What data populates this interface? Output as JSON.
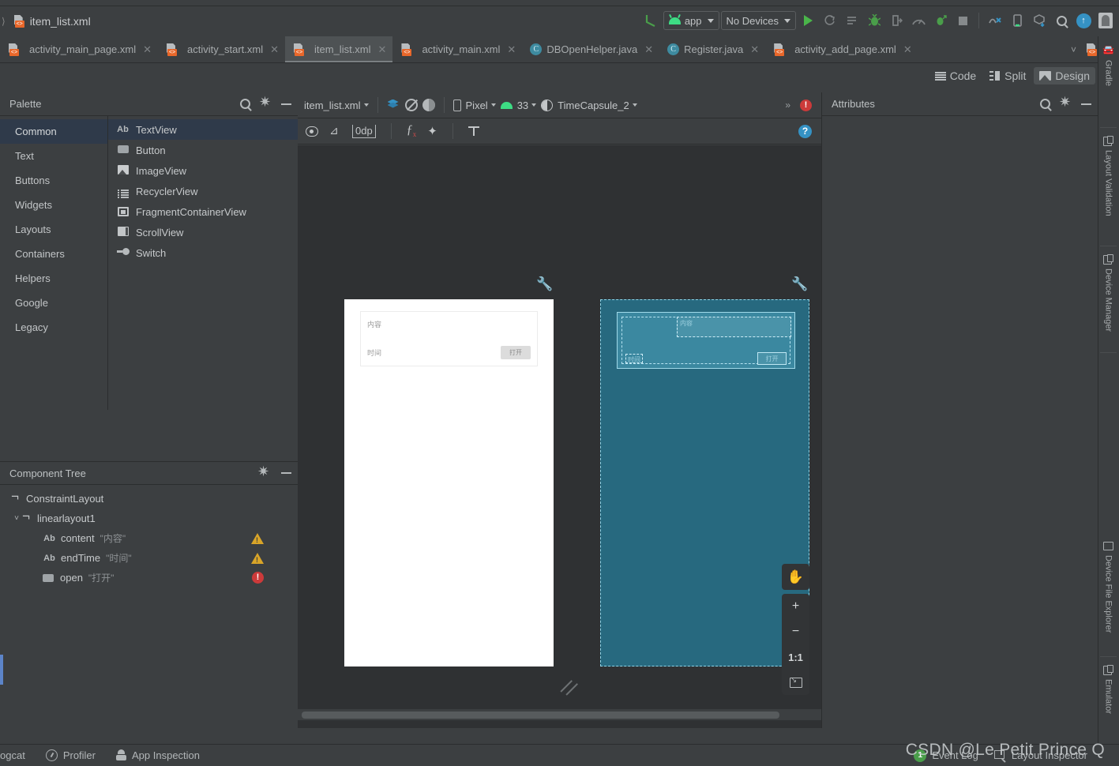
{
  "window": {
    "breadcrumb_file": "item_list.xml"
  },
  "toolbar": {
    "module_selector": "app",
    "device_selector": "No Devices",
    "icons": [
      "back-arrow-icon",
      "run-icon",
      "apply-changes-icon",
      "apply-code-changes-icon",
      "debug-icon",
      "attach-debugger-icon",
      "profiler-icon",
      "run-coverage-icon",
      "stop-icon",
      "avd-manager-icon",
      "device-manager-icon",
      "sdk-manager-icon",
      "search-everywhere-icon",
      "update-icon",
      "account-icon"
    ]
  },
  "editor_tabs": [
    {
      "label": "activity_main_page.xml",
      "type": "xml",
      "active": false
    },
    {
      "label": "activity_start.xml",
      "type": "xml",
      "active": false
    },
    {
      "label": "item_list.xml",
      "type": "xml",
      "active": true
    },
    {
      "label": "activity_main.xml",
      "type": "xml",
      "active": false
    },
    {
      "label": "DBOpenHelper.java",
      "type": "java",
      "active": false
    },
    {
      "label": "Register.java",
      "type": "java",
      "active": false
    },
    {
      "label": "activity_add_page.xml",
      "type": "xml",
      "active": false
    }
  ],
  "view_modes": {
    "code": "Code",
    "split": "Split",
    "design": "Design",
    "selected": "Design"
  },
  "palette": {
    "title": "Palette",
    "categories": [
      {
        "label": "Common",
        "selected": true
      },
      {
        "label": "Text",
        "selected": false
      },
      {
        "label": "Buttons",
        "selected": false
      },
      {
        "label": "Widgets",
        "selected": false
      },
      {
        "label": "Layouts",
        "selected": false
      },
      {
        "label": "Containers",
        "selected": false
      },
      {
        "label": "Helpers",
        "selected": false
      },
      {
        "label": "Google",
        "selected": false
      },
      {
        "label": "Legacy",
        "selected": false
      }
    ],
    "items": [
      {
        "label": "TextView",
        "icon": "ab-icon",
        "selected": true
      },
      {
        "label": "Button",
        "icon": "button-icon",
        "selected": false
      },
      {
        "label": "ImageView",
        "icon": "image-icon",
        "selected": false
      },
      {
        "label": "RecyclerView",
        "icon": "list-icon",
        "selected": false
      },
      {
        "label": "FragmentContainerView",
        "icon": "fragment-icon",
        "selected": false
      },
      {
        "label": "ScrollView",
        "icon": "scroll-icon",
        "selected": false
      },
      {
        "label": "Switch",
        "icon": "switch-icon",
        "selected": false
      }
    ]
  },
  "component_tree": {
    "title": "Component Tree",
    "nodes": [
      {
        "name": "ConstraintLayout",
        "value": "",
        "icon": "layout-icon",
        "indent": 0,
        "expander": "",
        "status": ""
      },
      {
        "name": "linearlayout1",
        "value": "",
        "icon": "layout-icon",
        "indent": 0,
        "expander": "expanded",
        "status": ""
      },
      {
        "name": "content",
        "value": "\"内容\"",
        "icon": "ab-icon",
        "indent": 2,
        "expander": "",
        "status": "warning"
      },
      {
        "name": "endTime",
        "value": "\"时间\"",
        "icon": "ab-icon",
        "indent": 2,
        "expander": "",
        "status": "warning"
      },
      {
        "name": "open",
        "value": "\"打开\"",
        "icon": "button-icon",
        "indent": 2,
        "expander": "",
        "status": "error"
      }
    ]
  },
  "design_toolbar": {
    "file": "item_list.xml",
    "device": "Pixel",
    "api_level": "33",
    "theme": "TimeCapsule_2",
    "overflow": "»",
    "margin_value": "0dp"
  },
  "preview": {
    "design_surface_labels": {
      "content": "内容",
      "time": "时间",
      "open": "打开"
    },
    "zoom_controls": {
      "pan": "pan-hand-icon",
      "zoom_in": "+",
      "zoom_out": "−",
      "actual_size": "1:1",
      "zoom_to_fit": "fit-icon"
    }
  },
  "attributes": {
    "title": "Attributes"
  },
  "right_rail": [
    {
      "label": "Gradle",
      "icon": "gradle-icon"
    },
    {
      "label": "Layout Validation",
      "icon": "layout-validation-icon"
    },
    {
      "label": "Device Manager",
      "icon": "device-manager-icon"
    },
    {
      "label": "Device File Explorer",
      "icon": "device-file-explorer-icon"
    },
    {
      "label": "Emulator",
      "icon": "emulator-icon"
    }
  ],
  "status_bar": {
    "left_items": [
      {
        "label": "ogcat",
        "icon": "logcat-icon"
      },
      {
        "label": "Profiler",
        "icon": "profiler-icon"
      },
      {
        "label": "App Inspection",
        "icon": "app-inspection-icon"
      }
    ],
    "event_log": {
      "label": "Event Log",
      "count": "1"
    },
    "layout_inspector": {
      "label": "Layout Inspector",
      "icon": "layout-inspector-icon"
    }
  },
  "watermark": "CSDN @Le Petit Prince Q",
  "colors": {
    "background": "#3c3f41",
    "canvas": "#2f3133",
    "selection": "#2f3a4a",
    "accent_orange": "#e8672a",
    "accent_blue": "#3592c4",
    "android_green": "#3ddc84",
    "blueprint": "#27697f",
    "warning": "#d9a528",
    "error": "#cc3a3a"
  }
}
